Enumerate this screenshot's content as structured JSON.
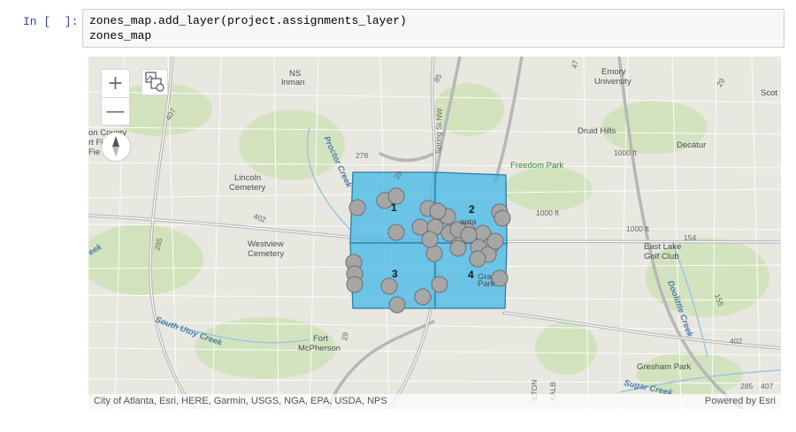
{
  "cell": {
    "prompt": "In [  ]:",
    "code_lines": [
      "zones_map.add_layer(project.assignments_layer)",
      "zones_map"
    ]
  },
  "map": {
    "controls": {
      "zoom_in": "+",
      "zoom_out": "—"
    },
    "place_labels": [
      {
        "text": "NS"
      },
      {
        "text": "Inman"
      },
      {
        "text": "Emory"
      },
      {
        "text": "University"
      },
      {
        "text": "Scot"
      },
      {
        "text": "Druid Hills"
      },
      {
        "text": "Decatur"
      },
      {
        "text": "on County"
      },
      {
        "text": "rt Fi"
      },
      {
        "text": "Fie"
      },
      {
        "text": "Lincoln"
      },
      {
        "text": "Cemetery"
      },
      {
        "text": "Westview"
      },
      {
        "text": "Cemetery"
      },
      {
        "text": "East Lake"
      },
      {
        "text": "Golf Club"
      },
      {
        "text": "Fort"
      },
      {
        "text": "McPherson"
      },
      {
        "text": "Gresham Park"
      },
      {
        "text": "Gra"
      },
      {
        "text": "Park"
      },
      {
        "text": "anta"
      }
    ],
    "green_labels": [
      {
        "text": "Freedom Park"
      }
    ],
    "water_labels": [
      {
        "text": "Proctor Creek"
      },
      {
        "text": "South Utoy Creek"
      },
      {
        "text": "Doolittle Creek"
      },
      {
        "text": "Sugar Creek"
      },
      {
        "text": "eek"
      }
    ],
    "road_labels": [
      {
        "text": "278"
      },
      {
        "text": "402"
      },
      {
        "text": "285"
      },
      {
        "text": "407"
      },
      {
        "text": "29"
      },
      {
        "text": "154"
      },
      {
        "text": "155"
      },
      {
        "text": "402"
      },
      {
        "text": "85"
      },
      {
        "text": "29"
      },
      {
        "text": "Spring St NW"
      },
      {
        "text": "1000 ft"
      },
      {
        "text": "1000 ft"
      },
      {
        "text": "1000 ft"
      },
      {
        "text": "ILTON"
      },
      {
        "text": "KALB"
      },
      {
        "text": "47"
      },
      {
        "text": "407"
      },
      {
        "text": "285"
      },
      {
        "text": "29"
      }
    ],
    "zones": [
      {
        "label": "1"
      },
      {
        "label": "2"
      },
      {
        "label": "3"
      },
      {
        "label": "4"
      }
    ],
    "zone_fill": "#3ab5e8",
    "point_fill": "#a6a6a6",
    "assignment_point_count": 33,
    "attribution": {
      "left": "City of Atlanta, Esri, HERE, Garmin, USGS, NGA, EPA, USDA, NPS",
      "right": "Powered by Esri"
    }
  }
}
